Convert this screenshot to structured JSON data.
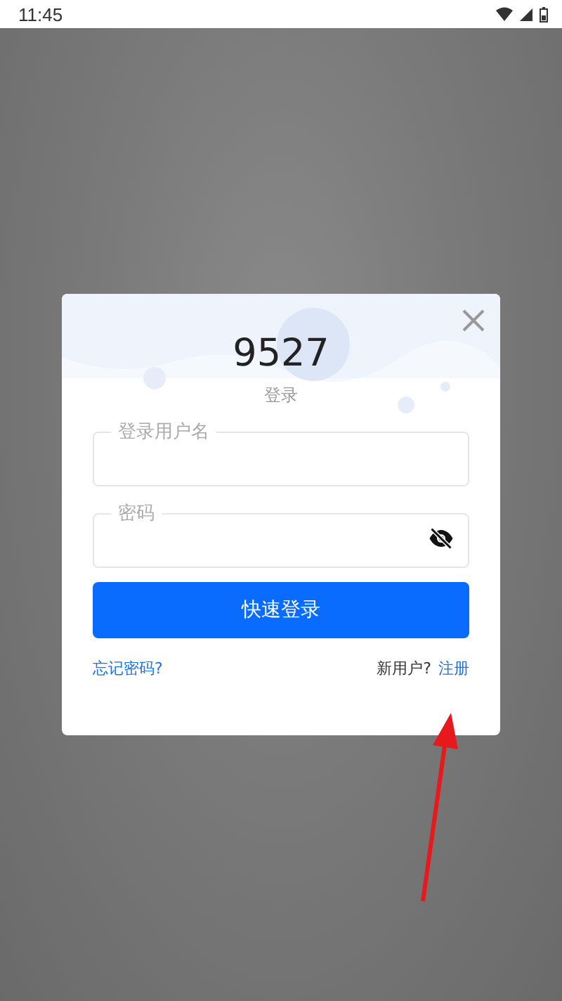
{
  "status_bar": {
    "time": "11:45"
  },
  "dialog": {
    "title": "9527",
    "subtitle": "登录",
    "fields": [
      {
        "kind": "text",
        "label": "登录用户名"
      },
      {
        "kind": "password",
        "label": "密码"
      }
    ],
    "submit": "快速登录",
    "forgot_link": "忘记密码?",
    "new_user_prompt": "新用户?",
    "register_link": "注册"
  },
  "annotation": {
    "kind": "arrow"
  }
}
